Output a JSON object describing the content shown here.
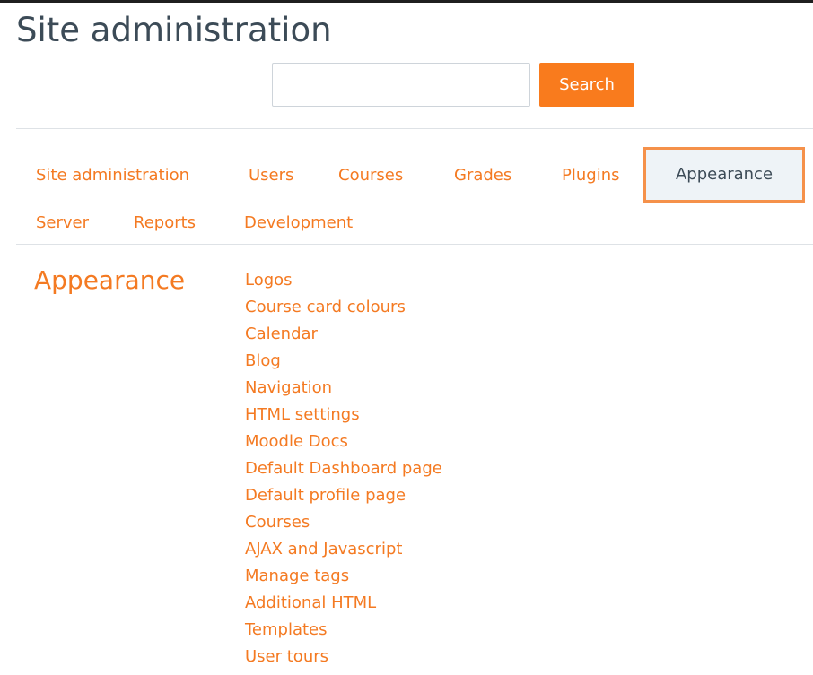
{
  "header": {
    "title": "Site administration"
  },
  "search": {
    "value": "",
    "placeholder": "",
    "button_label": "Search"
  },
  "tabs": [
    {
      "label": "Site administration",
      "active": false
    },
    {
      "label": "Users",
      "active": false
    },
    {
      "label": "Courses",
      "active": false
    },
    {
      "label": "Grades",
      "active": false
    },
    {
      "label": "Plugins",
      "active": false
    },
    {
      "label": "Appearance",
      "active": true
    },
    {
      "label": "Server",
      "active": false
    },
    {
      "label": "Reports",
      "active": false
    },
    {
      "label": "Development",
      "active": false
    }
  ],
  "section": {
    "title": "Appearance",
    "links": [
      "Logos",
      "Course card colours",
      "Calendar",
      "Blog",
      "Navigation",
      "HTML settings",
      "Moodle Docs",
      "Default Dashboard page",
      "Default profile page",
      "Courses",
      "AJAX and Javascript",
      "Manage tags",
      "Additional HTML",
      "Templates",
      "User tours"
    ]
  },
  "colors": {
    "accent": "#f97b1d",
    "link": "#f47a22",
    "title_text": "#3c4b57",
    "active_tab_border": "#f5914a",
    "active_tab_bg": "#eef3f7"
  }
}
